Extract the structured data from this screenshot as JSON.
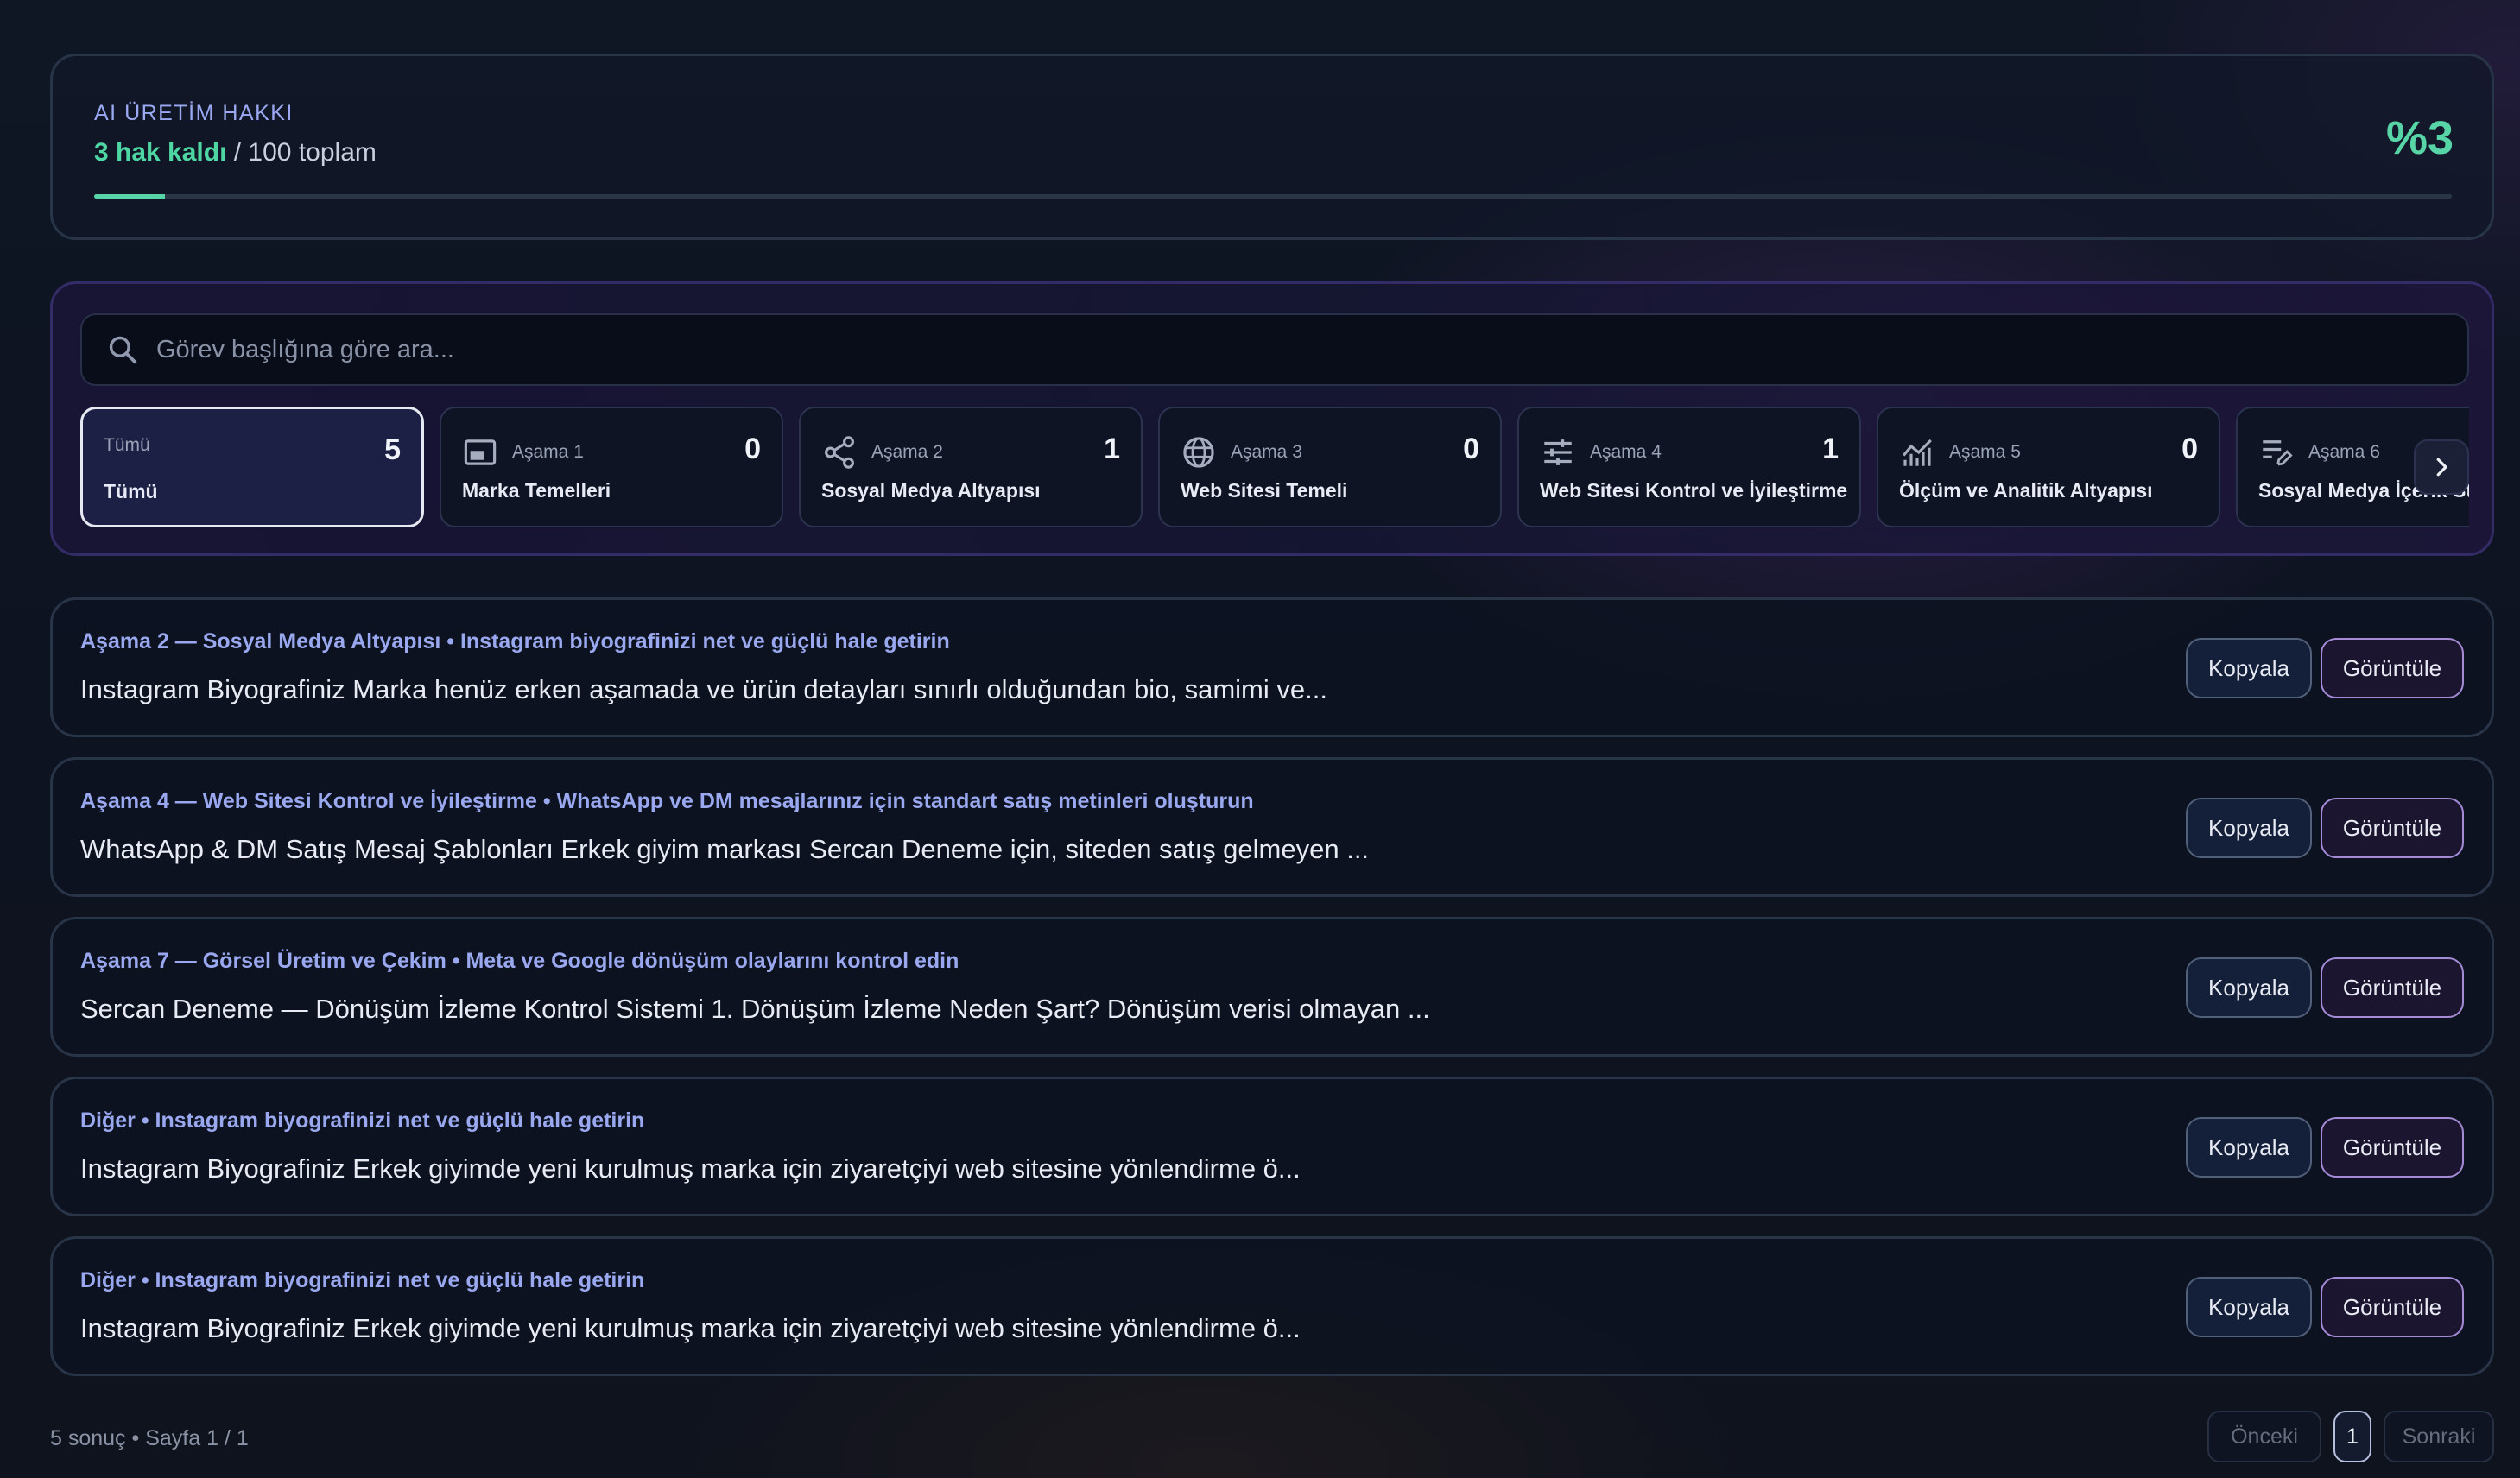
{
  "quota": {
    "label": "AI ÜRETİM HAKKI",
    "remaining": "3 hak kaldı",
    "total": "/ 100 toplam",
    "percent": "%3",
    "fraction": 0.03,
    "accent": "#57d5a7"
  },
  "search": {
    "placeholder": "Görev başlığına göre ara...",
    "icon": "search-icon"
  },
  "tabs": [
    {
      "stage": "Tümü",
      "count": "5",
      "name": "Tümü",
      "icon": "",
      "active": true
    },
    {
      "stage": "Aşama 1",
      "count": "0",
      "name": "Marka Temelleri",
      "icon": "picture-in-picture-icon"
    },
    {
      "stage": "Aşama 2",
      "count": "1",
      "name": "Sosyal Medya Altyapısı",
      "icon": "share-icon"
    },
    {
      "stage": "Aşama 3",
      "count": "0",
      "name": "Web Sitesi Temeli",
      "icon": "globe-icon"
    },
    {
      "stage": "Aşama 4",
      "count": "1",
      "name": "Web Sitesi Kontrol ve İyileştirme",
      "icon": "sliders-icon"
    },
    {
      "stage": "Aşama 5",
      "count": "0",
      "name": "Ölçüm ve Analitik Altyapısı",
      "icon": "analytics-icon"
    },
    {
      "stage": "Aşama 6",
      "count": "",
      "name": "Sosyal Medya İçerik St",
      "icon": "edit-note-icon"
    }
  ],
  "results": [
    {
      "meta": "Aşama 2 — Sosyal Medya Altyapısı • Instagram biyografinizi net ve güçlü hale getirin",
      "text": "Instagram Biyografiniz Marka henüz erken aşamada ve ürün detayları sınırlı olduğundan bio, samimi ve..."
    },
    {
      "meta": "Aşama 4 — Web Sitesi Kontrol ve İyileştirme • WhatsApp ve DM mesajlarınız için standart satış metinleri oluşturun",
      "text": "WhatsApp & DM Satış Mesaj Şablonları Erkek giyim markası Sercan Deneme için, siteden satış gelmeyen ..."
    },
    {
      "meta": "Aşama 7 — Görsel Üretim ve Çekim • Meta ve Google dönüşüm olaylarını kontrol edin",
      "text": "Sercan Deneme — Dönüşüm İzleme Kontrol Sistemi 1. Dönüşüm İzleme Neden Şart? Dönüşüm verisi olmayan ..."
    },
    {
      "meta": "Diğer • Instagram biyografinizi net ve güçlü hale getirin",
      "text": "Instagram Biyografiniz Erkek giyimde yeni kurulmuş marka için ziyaretçiyi web sitesine yönlendirme ö..."
    },
    {
      "meta": "Diğer • Instagram biyografinizi net ve güçlü hale getirin",
      "text": "Instagram Biyografiniz Erkek giyimde yeni kurulmuş marka için ziyaretçiyi web sitesine yönlendirme ö..."
    }
  ],
  "buttons": {
    "copy": "Kopyala",
    "view": "Görüntüle"
  },
  "footer": {
    "info": "5 sonuç • Sayfa 1 / 1",
    "prev": "Önceki",
    "page": "1",
    "next": "Sonraki"
  }
}
